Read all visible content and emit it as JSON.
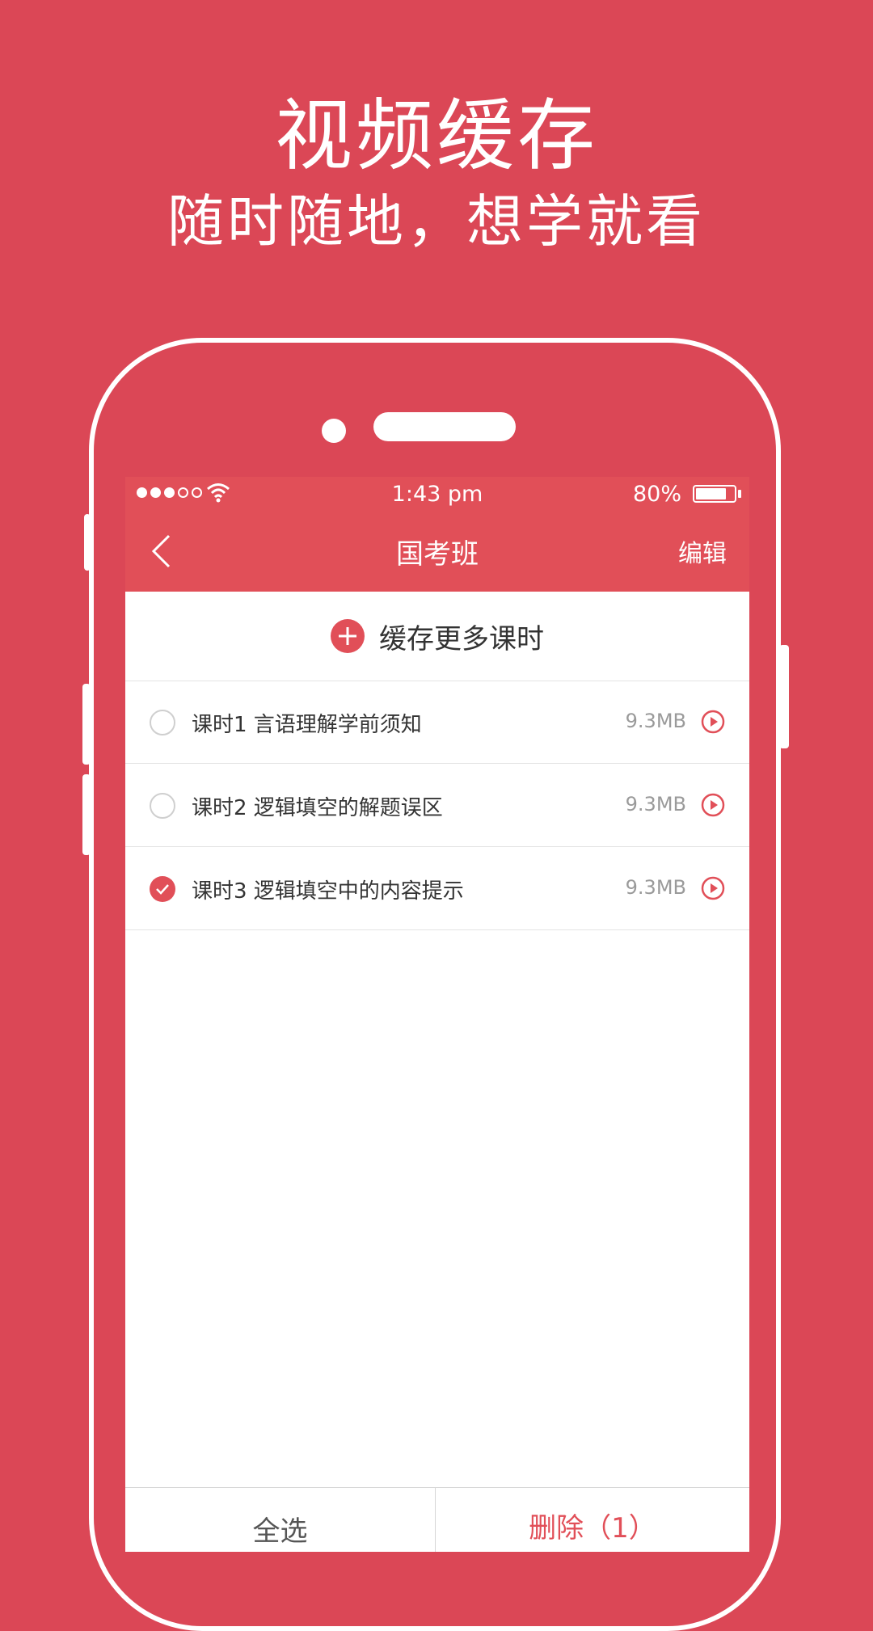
{
  "promo": {
    "headline": "视频缓存",
    "subline": "随时随地，想学就看"
  },
  "status_bar": {
    "time": "1:43 pm",
    "battery": "80%"
  },
  "nav": {
    "title": "国考班",
    "edit_label": "编辑"
  },
  "cache_more": {
    "label": "缓存更多课时"
  },
  "lessons": [
    {
      "title": "课时1  言语理解学前须知",
      "size": "9.3MB",
      "checked": false
    },
    {
      "title": "课时2  逻辑填空的解题误区",
      "size": "9.3MB",
      "checked": false
    },
    {
      "title": "课时3  逻辑填空中的内容提示",
      "size": "9.3MB",
      "checked": true
    }
  ],
  "bottom": {
    "select_all": "全选",
    "delete": "删除（1）"
  },
  "colors": {
    "background": "#db4756",
    "accent": "#e14f58"
  }
}
